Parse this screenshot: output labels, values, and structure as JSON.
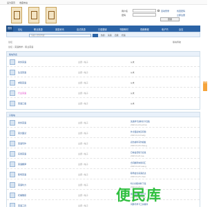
{
  "topbar": {
    "left": "设为首页",
    "mid": "收藏本站"
  },
  "login": {
    "user_label": "用户名",
    "pass_label": "密码",
    "remember": "自动登录",
    "find_pass": "找回密码",
    "register": "立即注册",
    "login_btn": "登录",
    "register_btn": "注册"
  },
  "nav": {
    "items": [
      "首页",
      "论坛",
      "职业英语",
      "英语资讯",
      "应试英语",
      "口语翻译",
      "书籍教材",
      "视频教程",
      "电子书",
      "杂志"
    ],
    "current_index": 0
  },
  "search": {
    "placeholder": "请输入搜索内容",
    "button": "搜索",
    "hot_label": "热搜:",
    "hot_items": [
      "英语",
      "四级",
      "托福"
    ]
  },
  "crumb": {
    "home": "论坛",
    "path": "论坛 › 英语教学 › 职业英语",
    "manage": "版主: 管理员"
  },
  "crumb_right": "版块导航",
  "section_a": {
    "title": "版块列表",
    "rows": [
      {
        "name": "商务英语",
        "stat": "主题 / 帖子",
        "last": "从未"
      },
      {
        "name": "生活英语",
        "stat": "主题 / 帖子",
        "last": "从未"
      },
      {
        "name": "求职英语",
        "stat": "主题 / 帖子",
        "last": "从未"
      },
      {
        "name": "行业英语",
        "stat": "主题 / 帖子",
        "last": "从未",
        "pink": true
      },
      {
        "name": "英语口语",
        "stat": "主题 / 帖子",
        "last": "从未"
      }
    ]
  },
  "section_b": {
    "title": "子版块",
    "rows": [
      {
        "name": "商务英语",
        "stat": "主题 / 帖子",
        "last_title": "英语学习资料分享合集",
        "last_meta": "2023-9-18 admin"
      },
      {
        "name": "英文面试",
        "stat": "主题 / 帖子",
        "last_title": "外企面试常见问题",
        "last_meta": "2023-9-19 kelly"
      },
      {
        "name": "英语写作",
        "stat": "主题 / 帖子",
        "last_title": "商务邮件写作模板",
        "last_meta": "2023-9-20 zhang"
      },
      {
        "name": "实用英语",
        "stat": "主题 / 帖子",
        "last_title": "日常会话练习合集",
        "last_meta": "2023-9-21 lee"
      },
      {
        "name": "英语翻译",
        "stat": "主题 / 帖子",
        "last_title": "合同翻译常用词汇",
        "last_meta": "2023-9-22 wang"
      },
      {
        "name": "职场英语",
        "stat": "主题 / 帖子",
        "last_title": "职场会议英语表达",
        "last_meta": "2023-9-23 chen"
      },
      {
        "name": "英语听力",
        "stat": "主题 / 帖子",
        "last_title": "听力训练材料下载",
        "last_meta": "2023-9-24 liu"
      },
      {
        "name": "托福雅思",
        "stat": "主题 / 帖子",
        "last_title": "备考经验交流分享",
        "last_meta": "2023-9-25 zhao"
      },
      {
        "name": "英语工具",
        "stat": "主题 / 帖子",
        "last_title": "词典与学习工具推荐",
        "last_meta": "2023-9-26 sun"
      }
    ]
  },
  "float_btn": "反馈",
  "watermark": "便民库",
  "colors": {
    "nav_blue": "#2b63a6",
    "link_blue": "#2a5a99",
    "float_orange": "#f5a33a",
    "watermark_green": "#2fbf3f"
  }
}
